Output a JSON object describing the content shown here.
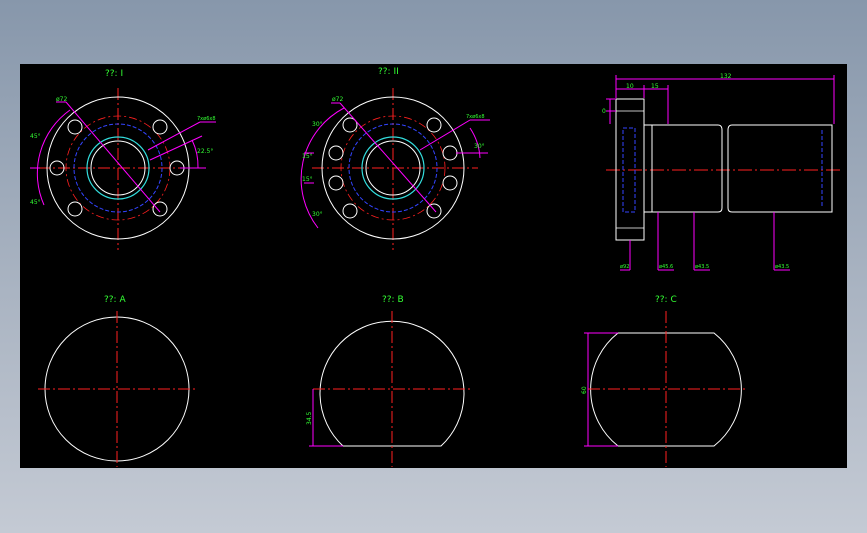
{
  "colors": {
    "background": "#000000",
    "outline": "#ffffff",
    "center_line": "#ff2020",
    "dimension": "#ff00ff",
    "hidden": "#3344ff",
    "text": "#33ff33",
    "cyan": "#33dddd"
  },
  "views": {
    "view_1": {
      "title": "??: I"
    },
    "view_2": {
      "title": "??: II"
    },
    "view_a": {
      "title": "??: A"
    },
    "view_b": {
      "title": "??: B"
    },
    "view_c": {
      "title": "??: C"
    }
  },
  "dimensions": {
    "v1_dia": "ø72",
    "v1_angle_top": "45°",
    "v1_angle_bottom": "45°",
    "v1_holes": "7xø6x8",
    "v1_angle_right": "22.5°",
    "v2_dia": "ø72",
    "v2_angle_a": "30°",
    "v2_angle_b": "15°",
    "v2_angle_c": "15°",
    "v2_angle_d": "30°",
    "v2_holes": "7xø6x8",
    "v2_angle_right": "30°",
    "side_w1": "10",
    "side_w2": "15",
    "side_total": "132",
    "side_left": "0",
    "side_d1": "ø92",
    "side_d2": "ø45.6",
    "side_d3": "ø43.5",
    "side_d4": "ø43.5",
    "view_b_height": "34.5",
    "view_c_height": "60"
  }
}
